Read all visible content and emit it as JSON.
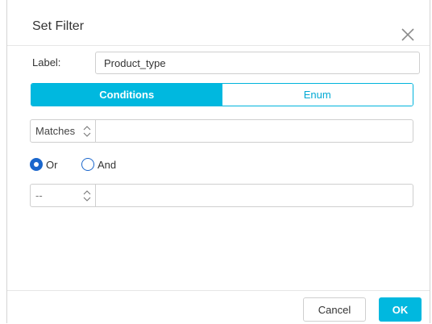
{
  "dialog": {
    "title": "Set Filter",
    "close_icon": "close-icon"
  },
  "label_field": {
    "label": "Label:",
    "value": "Product_type"
  },
  "tabs": [
    {
      "label": "Conditions",
      "active": true
    },
    {
      "label": "Enum",
      "active": false
    }
  ],
  "condition1": {
    "operator": "Matches",
    "value": ""
  },
  "logic": {
    "options": [
      {
        "label": "Or",
        "checked": true
      },
      {
        "label": "And",
        "checked": false
      }
    ]
  },
  "condition2": {
    "operator": "--",
    "value": ""
  },
  "footer": {
    "cancel_label": "Cancel",
    "ok_label": "OK"
  },
  "colors": {
    "accent": "#00b8df",
    "radio": "#1a66cc",
    "border": "#cfcfcf"
  }
}
